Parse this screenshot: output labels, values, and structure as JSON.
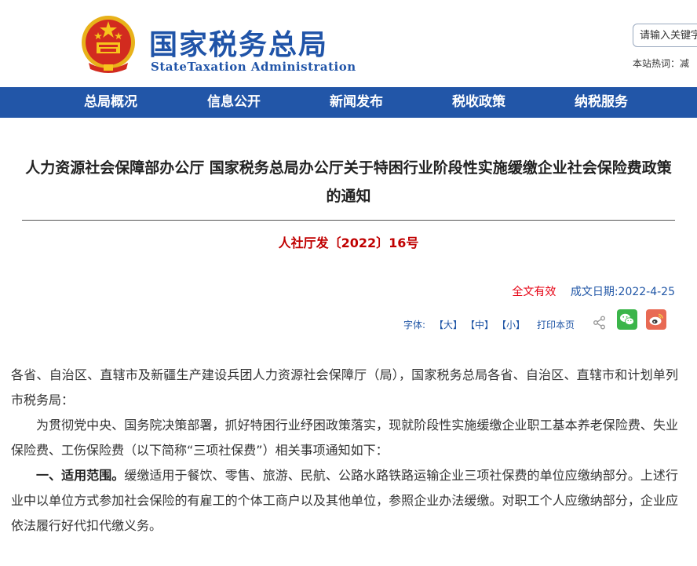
{
  "header": {
    "logo_cn": "国家税务总局",
    "logo_en": "StateTaxation Administration",
    "search_placeholder": "请输入关键字",
    "hot_words": "本站热词：减"
  },
  "nav": {
    "items": [
      {
        "label": "总局概况"
      },
      {
        "label": "信息公开"
      },
      {
        "label": "新闻发布"
      },
      {
        "label": "税收政策"
      },
      {
        "label": "纳税服务"
      }
    ]
  },
  "article": {
    "title": "人力资源社会保障部办公厅 国家税务总局办公厅关于特困行业阶段性实施缓缴企业社会保险费政策的通知",
    "doc_number": "人社厅发〔2022〕16号",
    "validity": "全文有效",
    "date": "成文日期:2022-4-25",
    "font_label": "字体:",
    "font_large": "【大】",
    "font_medium": "【中】",
    "font_small": "【小】",
    "print": "打印本页",
    "paragraphs": [
      "各省、自治区、直辖市及新疆生产建设兵团人力资源社会保障厅（局），国家税务总局各省、自治区、直辖市和计划单列市税务局：",
      "为贯彻党中央、国务院决策部署，抓好特困行业纾困政策落实，现就阶段性实施缓缴企业职工基本养老保险费、失业保险费、工伤保险费（以下简称“三项社保费”）相关事项通知如下："
    ],
    "section1_heading": "一、适用范围。",
    "section1_text": "缓缴适用于餐饮、零售、旅游、民航、公路水路铁路运输企业三项社保费的单位应缴纳部分。上述行业中以单位方式参加社会保险的有雇工的个体工商户以及其他单位，参照企业办法缓缴。对职工个人应缴纳部分，企业应依法履行好代扣代缴义务。"
  },
  "colors": {
    "nav_bg": "#2256a8",
    "brand_blue": "#2054a8",
    "doc_red": "#c00000",
    "link_blue": "#2056a6"
  }
}
